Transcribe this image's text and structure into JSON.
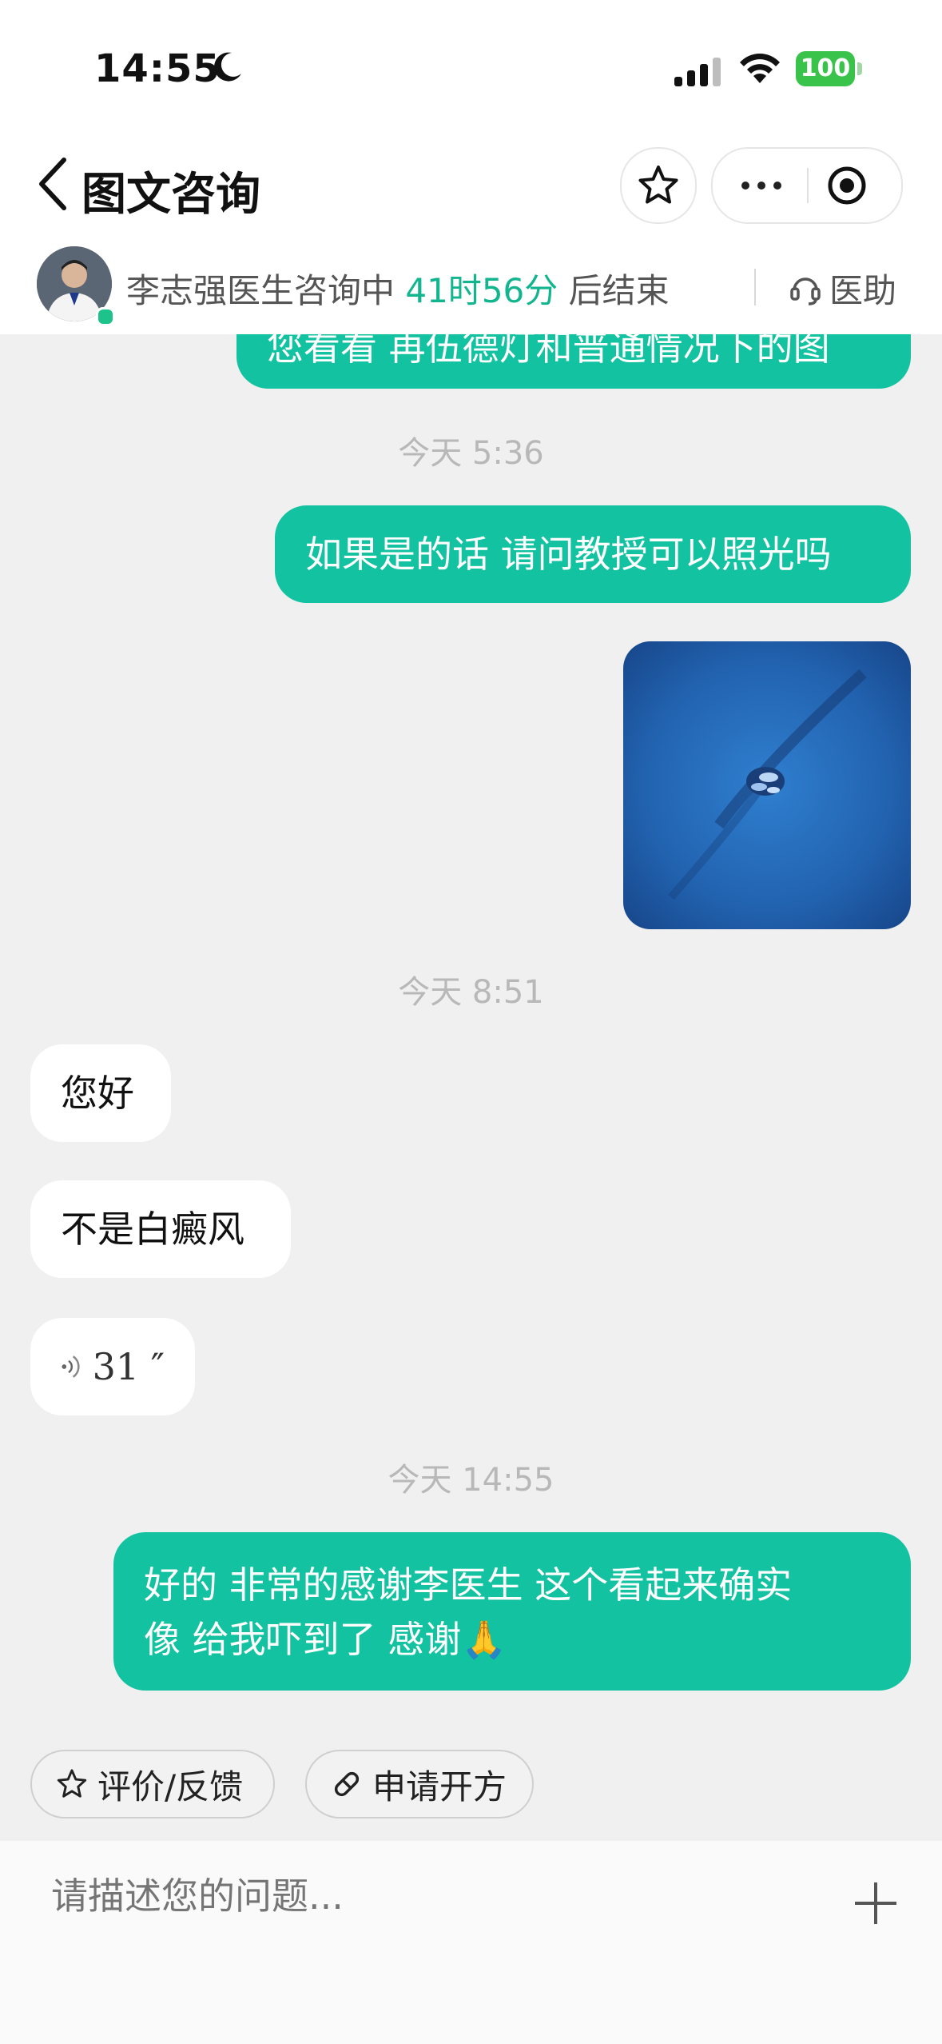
{
  "status_bar": {
    "time": "14:55",
    "battery": "100"
  },
  "nav": {
    "title": "图文咨询"
  },
  "doctor": {
    "status_prefix": "李志强医生咨询中",
    "remaining": "41时56分",
    "status_suffix": "后结束",
    "assistant_label": "医助"
  },
  "chat": {
    "partial_top": "您看看 再伍德灯和普通情况下的图",
    "stamp1": "今天 5:36",
    "msg1": "如果是的话 请问教授可以照光吗",
    "stamp2": "今天 8:51",
    "reply1": "您好",
    "reply2": "不是白癜风",
    "voice_duration": "31 ″",
    "stamp3": "今天 14:55",
    "msg2_line1": "好的 非常的感谢李医生 这个看起来确实",
    "msg2_line2": "像 给我吓到了 感谢🙏"
  },
  "actions": {
    "feedback": "评价/反馈",
    "prescription": "申请开方"
  },
  "input": {
    "placeholder": "请描述您的问题..."
  },
  "colors": {
    "accent": "#13c2a0",
    "battery": "#3ac34b",
    "highlight": "#13b58f"
  }
}
